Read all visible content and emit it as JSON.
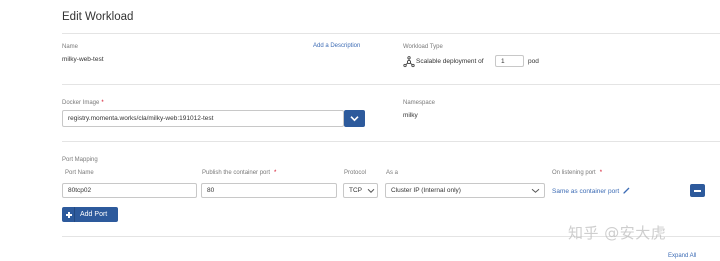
{
  "header": {
    "title": "Edit Workload"
  },
  "name": {
    "label": "Name",
    "value": "milky-web-test",
    "add_description": "Add a Description"
  },
  "workload_type": {
    "label": "Workload Type",
    "prefix": "Scalable deployment of",
    "count": "1",
    "suffix": "pod"
  },
  "docker_image": {
    "label": "Docker Image",
    "required_mark": "*",
    "value": "registry.momenta.works/cla/milky-web:191012-test"
  },
  "namespace": {
    "label": "Namespace",
    "value": "milky"
  },
  "port_mapping": {
    "section_label": "Port Mapping",
    "columns": {
      "port_name": "Port Name",
      "publish_port": "Publish the container port",
      "protocol": "Protocol",
      "as_a": "As a",
      "on_listening_port": "On listening port"
    },
    "required_mark": "*",
    "rows": [
      {
        "port_name": "80tcp02",
        "publish_port": "80",
        "protocol": "TCP",
        "as_a": "Cluster IP (Internal only)",
        "listening_port": "Same as container port"
      }
    ],
    "add_port_label": "Add Port"
  },
  "footer": {
    "expand_all": "Expand All"
  },
  "watermark": "知乎 @安大虎",
  "colors": {
    "accent": "#2d5a9c",
    "link": "#3d6cb5",
    "required": "#d0021b"
  },
  "icons": [
    "network-deploy-icon",
    "chevron-down-icon",
    "pencil-icon",
    "minus-icon",
    "plus-icon"
  ]
}
